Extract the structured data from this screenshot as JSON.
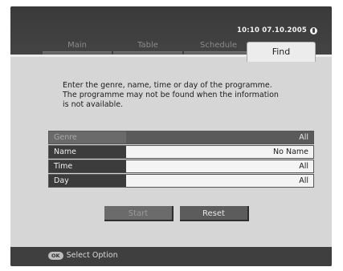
{
  "header": {
    "clock": "10:10 07.10.2005",
    "tabs": [
      {
        "label": "Main"
      },
      {
        "label": "Table"
      },
      {
        "label": "Schedule"
      },
      {
        "label": "Find",
        "active": true
      }
    ]
  },
  "main": {
    "instructions": "Enter the genre, name, time or day of the programme.\nThe programme may not be found when the information\nis not available.",
    "fields": [
      {
        "label": "Genre",
        "value": "All",
        "selected": true
      },
      {
        "label": "Name",
        "value": "No Name"
      },
      {
        "label": "Time",
        "value": "All"
      },
      {
        "label": "Day",
        "value": "All"
      }
    ],
    "buttons": {
      "start": "Start",
      "reset": "Reset"
    }
  },
  "footer": {
    "ok_badge": "OK",
    "hint": "Select Option"
  },
  "icons": {
    "clock_indicator": "globe-icon",
    "ok_key": "ok-button-icon"
  },
  "colors": {
    "panel": "#d6d6d6",
    "frame": "#3f3f3f",
    "selected_row": "#5a5a5a"
  }
}
